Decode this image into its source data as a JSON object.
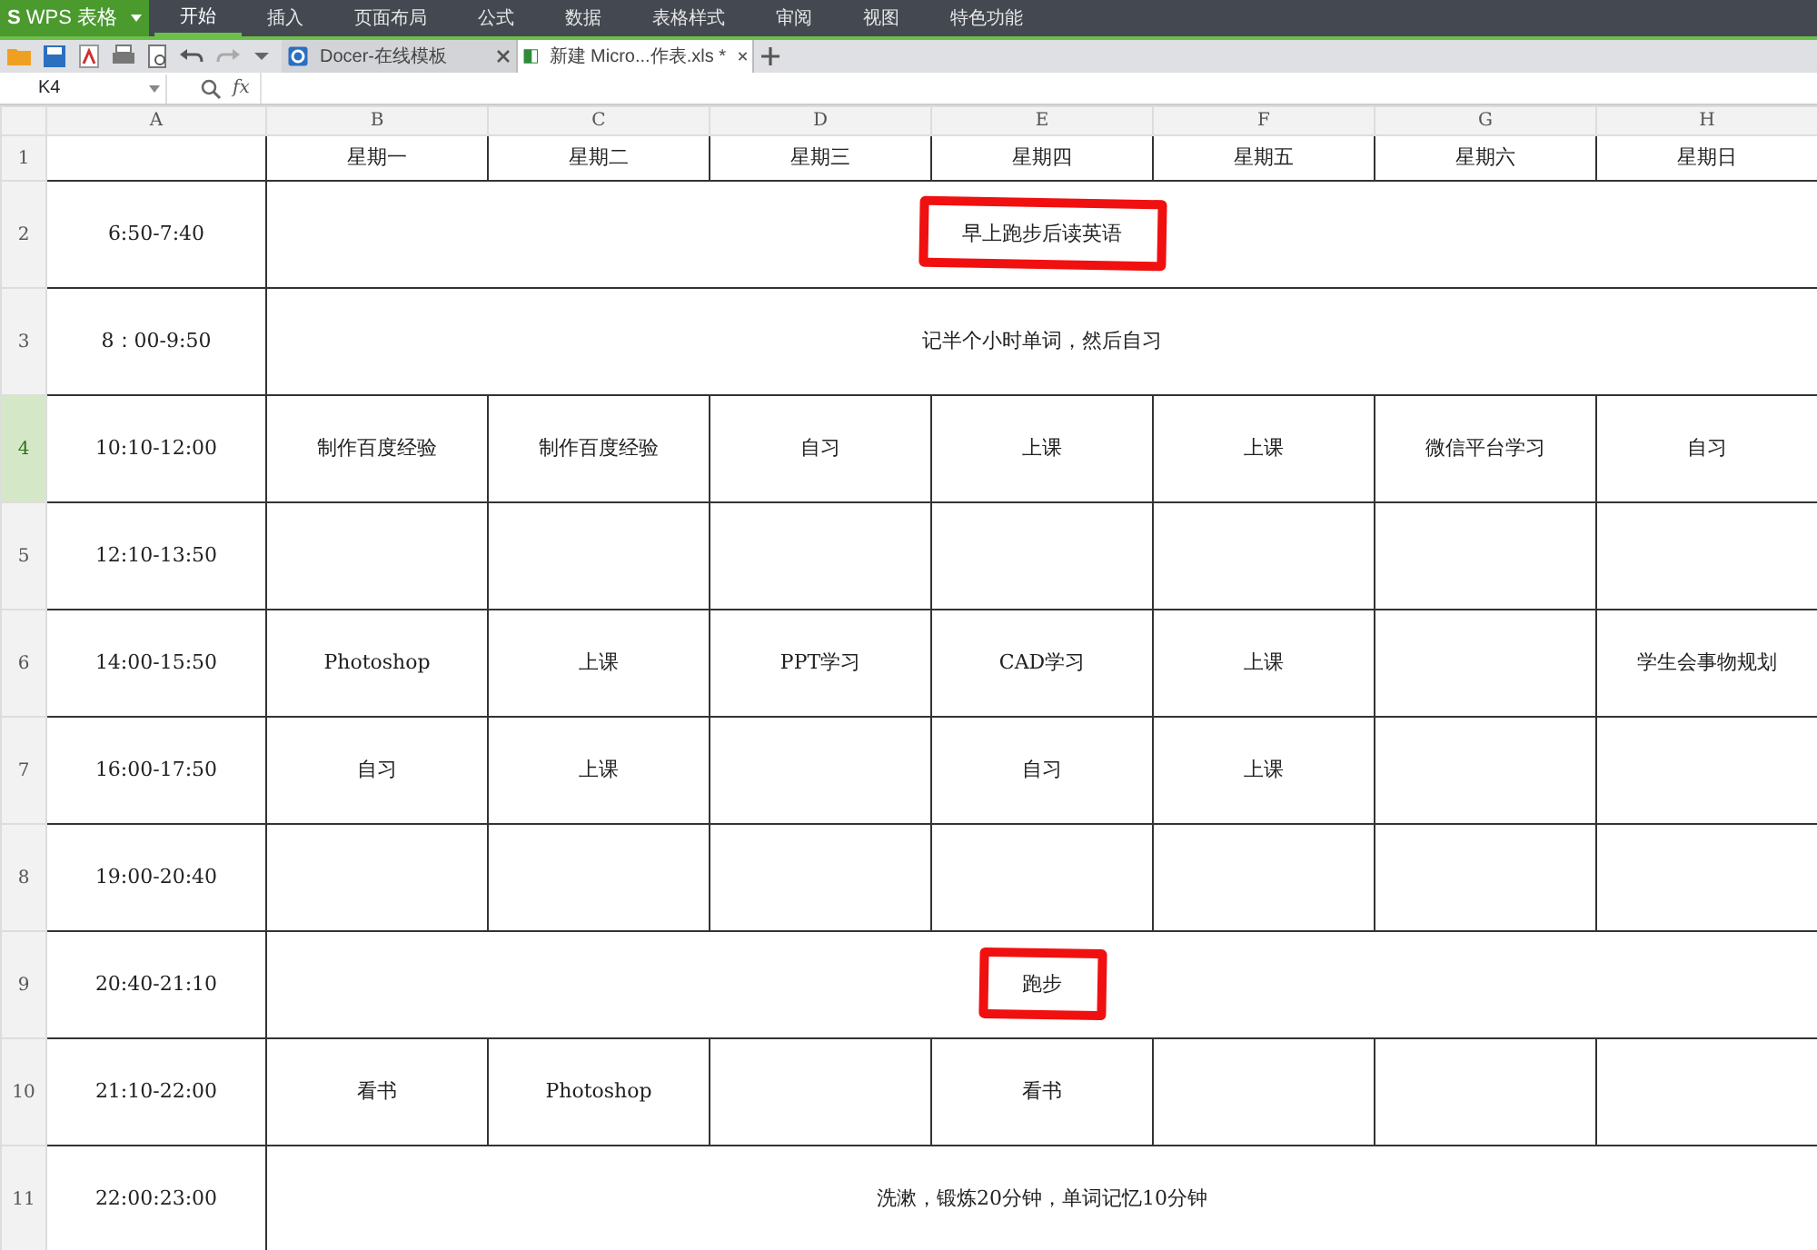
{
  "app": {
    "logo_letter": "S",
    "title": "WPS 表格"
  },
  "menu_tabs": [
    {
      "label": "开始",
      "selected": true
    },
    {
      "label": "插入",
      "selected": false
    },
    {
      "label": "页面布局",
      "selected": false
    },
    {
      "label": "公式",
      "selected": false
    },
    {
      "label": "数据",
      "selected": false
    },
    {
      "label": "表格样式",
      "selected": false
    },
    {
      "label": "审阅",
      "selected": false
    },
    {
      "label": "视图",
      "selected": false
    },
    {
      "label": "特色功能",
      "selected": false
    }
  ],
  "doc_tabs": [
    {
      "kind": "docer",
      "label": "Docer-在线模板",
      "selected": false
    },
    {
      "kind": "sheet",
      "label": "新建 Micro...作表.xls *",
      "selected": true
    }
  ],
  "formula_bar": {
    "cell_ref": "K4",
    "fx": "fx"
  },
  "columns": [
    "A",
    "B",
    "C",
    "D",
    "E",
    "F",
    "G",
    "H"
  ],
  "header_row": {
    "number": "1",
    "cells": [
      "",
      "星期一",
      "星期二",
      "星期三",
      "星期四",
      "星期五",
      "星期六",
      "星期日"
    ]
  },
  "rows": [
    {
      "number": "2",
      "selected": false,
      "time": "6:50-7:40",
      "kind": "merged",
      "text": "早上跑步后读英语",
      "circled": true
    },
    {
      "number": "3",
      "selected": false,
      "time": "8：00-9:50",
      "kind": "merged",
      "text": "记半个小时单词，然后自习",
      "circled": false
    },
    {
      "number": "4",
      "selected": true,
      "time": "10:10-12:00",
      "kind": "split",
      "cells": [
        "制作百度经验",
        "制作百度经验",
        "自习",
        "上课",
        "上课",
        "微信平台学习",
        "自习"
      ]
    },
    {
      "number": "5",
      "selected": false,
      "time": "12:10-13:50",
      "kind": "split",
      "cells": [
        "",
        "",
        "",
        "",
        "",
        "",
        ""
      ]
    },
    {
      "number": "6",
      "selected": false,
      "time": "14:00-15:50",
      "kind": "split",
      "cells": [
        "Photoshop",
        "上课",
        "PPT学习",
        "CAD学习",
        "上课",
        "",
        "学生会事物规划"
      ]
    },
    {
      "number": "7",
      "selected": false,
      "time": "16:00-17:50",
      "kind": "split",
      "cells": [
        "自习",
        "上课",
        "",
        "自习",
        "上课",
        "",
        ""
      ]
    },
    {
      "number": "8",
      "selected": false,
      "time": "19:00-20:40",
      "kind": "split",
      "cells": [
        "",
        "",
        "",
        "",
        "",
        "",
        ""
      ]
    },
    {
      "number": "9",
      "selected": false,
      "time": "20:40-21:10",
      "kind": "merged",
      "text": "跑步",
      "circled": true
    },
    {
      "number": "10",
      "selected": false,
      "time": "21:10-22:00",
      "kind": "split",
      "cells": [
        "看书",
        "Photoshop",
        "",
        "看书",
        "",
        "",
        ""
      ]
    },
    {
      "number": "11",
      "selected": false,
      "time": "22:00:23:00",
      "kind": "merged",
      "text": "洗漱，锻炼20分钟，单词记忆10分钟",
      "circled": false
    }
  ]
}
